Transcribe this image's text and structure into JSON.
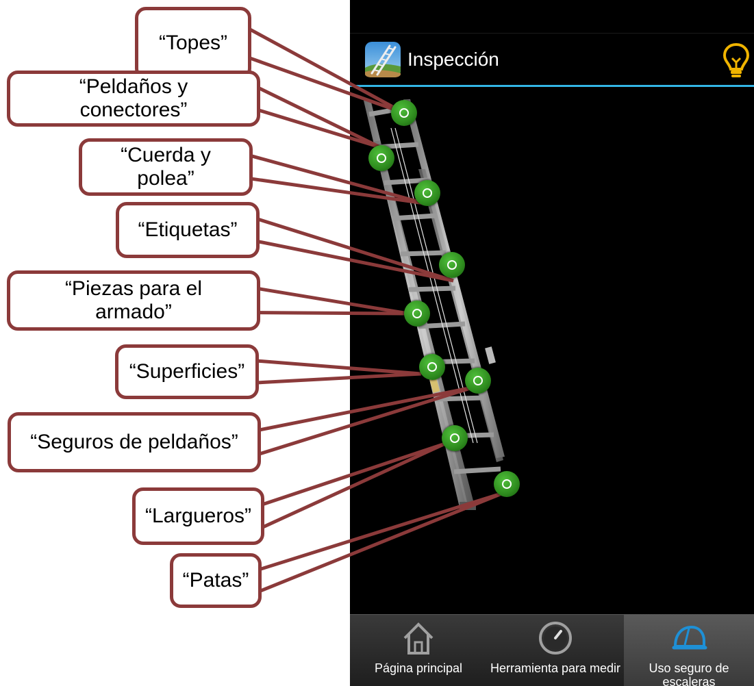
{
  "app": {
    "title": "Inspección",
    "accent_color": "#33b5e5",
    "app_icon": "ladder-icon",
    "hint_icon": "lightbulb-icon"
  },
  "content": {
    "image": "extension-ladder-illustration",
    "hotspot_color": "#2e8b1e",
    "hotspot_icon": "circle-target-icon"
  },
  "nav": {
    "items": [
      {
        "label": "Página principal",
        "icon": "house-icon",
        "active": false
      },
      {
        "label": "Herramienta para medir",
        "icon": "gauge-icon",
        "active": false
      },
      {
        "label": "Uso seguro de escaleras",
        "icon": "hard-hat-icon",
        "active": true
      }
    ]
  },
  "callouts": {
    "color": "#8b3a3a",
    "items": [
      {
        "label": "“Topes”"
      },
      {
        "label": "“Peldaños y\nconectores”"
      },
      {
        "label": "“Cuerda y\npolea”"
      },
      {
        "label": "“Etiquetas”"
      },
      {
        "label": "“Piezas para el\narmado”"
      },
      {
        "label": "“Superficies”"
      },
      {
        "label": "“Seguros de peldaños”"
      },
      {
        "label": "“Largueros”"
      },
      {
        "label": "“Patas”"
      }
    ]
  }
}
